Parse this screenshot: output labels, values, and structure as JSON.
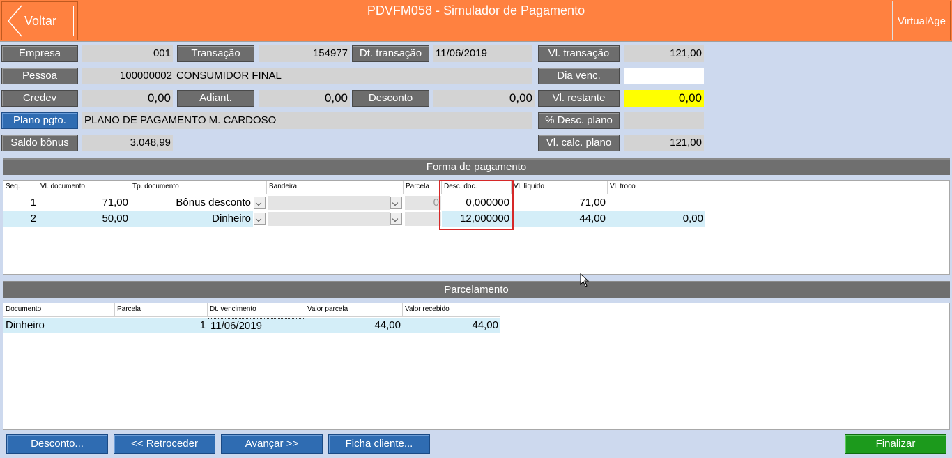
{
  "header": {
    "back_label": "Voltar",
    "title": "PDVFM058 - Simulador de Pagamento",
    "virtualage_label": "VirtualAge"
  },
  "form": {
    "empresa_label": "Empresa",
    "empresa_value": "001",
    "transacao_label": "Transação",
    "transacao_value": "154977",
    "dt_transacao_label": "Dt. transação",
    "dt_transacao_value": "11/06/2019",
    "vl_transacao_label": "Vl. transação",
    "vl_transacao_value": "121,00",
    "pessoa_label": "Pessoa",
    "pessoa_code": "100000002",
    "pessoa_name": "CONSUMIDOR FINAL",
    "dia_venc_label": "Dia venc.",
    "dia_venc_value": "",
    "credev_label": "Credev",
    "credev_value": "0,00",
    "adiant_label": "Adiant.",
    "adiant_value": "0,00",
    "desconto_label": "Desconto",
    "desconto_value": "0,00",
    "vl_restante_label": "Vl. restante",
    "vl_restante_value": "0,00",
    "plano_label": "Plano pgto.",
    "plano_value": "PLANO DE PAGAMENTO M. CARDOSO",
    "desc_plano_label": "% Desc. plano",
    "desc_plano_value": "",
    "saldo_bonus_label": "Saldo bônus",
    "saldo_bonus_value": "3.048,99",
    "vl_calc_plano_label": "Vl. calc. plano",
    "vl_calc_plano_value": "121,00"
  },
  "forma_pagamento": {
    "title": "Forma de pagamento",
    "columns": [
      "Seq.",
      "Vl. documento",
      "Tp. documento",
      "Bandeira",
      "Parcela",
      "Desc. doc.",
      "Vl. líquido",
      "Vl. troco"
    ],
    "rows": [
      {
        "seq": "1",
        "vl_documento": "71,00",
        "tp_documento": "Bônus desconto",
        "bandeira": "",
        "parcela": "0",
        "desc_doc": "0,000000",
        "vl_liquido": "71,00",
        "vl_troco": ""
      },
      {
        "seq": "2",
        "vl_documento": "50,00",
        "tp_documento": "Dinheiro",
        "bandeira": "",
        "parcela": "",
        "desc_doc": "12,000000",
        "vl_liquido": "44,00",
        "vl_troco": "0,00"
      }
    ]
  },
  "parcelamento": {
    "title": "Parcelamento",
    "columns": [
      "Documento",
      "Parcela",
      "Dt. vencimento",
      "Valor parcela",
      "Valor recebido"
    ],
    "rows": [
      {
        "documento": "Dinheiro",
        "parcela": "1",
        "dt_vencimento": "11/06/2019",
        "valor_parcela": "44,00",
        "valor_recebido": "44,00"
      }
    ]
  },
  "footer": {
    "desconto": "Desconto...",
    "retroceder": "<< Retroceder",
    "avancar": "Avançar >>",
    "ficha_cliente": "Ficha cliente...",
    "finalizar": "Finalizar"
  },
  "colors": {
    "header": "#ff8140",
    "background": "#cdd9ee",
    "label_button": "#6d6d6d",
    "blue_button": "#2f6cb2",
    "green_button": "#1c9a1c",
    "highlight_row": "#d4eef8",
    "restante_field": "#ffff00",
    "annotation_box": "#d62828"
  }
}
